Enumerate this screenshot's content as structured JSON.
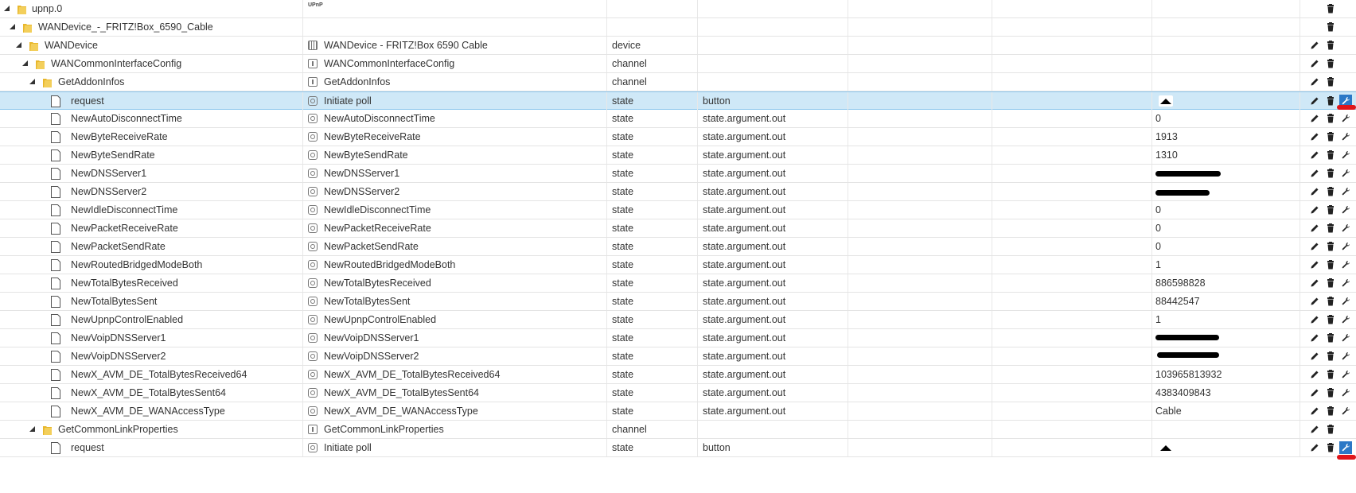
{
  "rows": [
    {
      "name": "upnp.0",
      "title": "",
      "type": "",
      "role": "",
      "value": ""
    },
    {
      "name": "WANDevice_-_FRITZ!Box_6590_Cable",
      "title": "",
      "type": "",
      "role": "",
      "value": ""
    },
    {
      "name": "WANDevice",
      "title": "WANDevice - FRITZ!Box 6590 Cable",
      "type": "device",
      "role": "",
      "value": ""
    },
    {
      "name": "WANCommonInterfaceConfig",
      "title": "WANCommonInterfaceConfig",
      "type": "channel",
      "role": "",
      "value": ""
    },
    {
      "name": "GetAddonInfos",
      "title": "GetAddonInfos",
      "type": "channel",
      "role": "",
      "value": ""
    },
    {
      "name": "request",
      "title": "Initiate poll",
      "type": "state",
      "role": "button",
      "value": ""
    },
    {
      "name": "NewAutoDisconnectTime",
      "title": "NewAutoDisconnectTime",
      "type": "state",
      "role": "state.argument.out",
      "value": "0"
    },
    {
      "name": "NewByteReceiveRate",
      "title": "NewByteReceiveRate",
      "type": "state",
      "role": "state.argument.out",
      "value": "1913"
    },
    {
      "name": "NewByteSendRate",
      "title": "NewByteSendRate",
      "type": "state",
      "role": "state.argument.out",
      "value": "1310"
    },
    {
      "name": "NewDNSServer1",
      "title": "NewDNSServer1",
      "type": "state",
      "role": "state.argument.out",
      "value": ""
    },
    {
      "name": "NewDNSServer2",
      "title": "NewDNSServer2",
      "type": "state",
      "role": "state.argument.out",
      "value": ""
    },
    {
      "name": "NewIdleDisconnectTime",
      "title": "NewIdleDisconnectTime",
      "type": "state",
      "role": "state.argument.out",
      "value": "0"
    },
    {
      "name": "NewPacketReceiveRate",
      "title": "NewPacketReceiveRate",
      "type": "state",
      "role": "state.argument.out",
      "value": "0"
    },
    {
      "name": "NewPacketSendRate",
      "title": "NewPacketSendRate",
      "type": "state",
      "role": "state.argument.out",
      "value": "0"
    },
    {
      "name": "NewRoutedBridgedModeBoth",
      "title": "NewRoutedBridgedModeBoth",
      "type": "state",
      "role": "state.argument.out",
      "value": "1"
    },
    {
      "name": "NewTotalBytesReceived",
      "title": "NewTotalBytesReceived",
      "type": "state",
      "role": "state.argument.out",
      "value": "886598828"
    },
    {
      "name": "NewTotalBytesSent",
      "title": "NewTotalBytesSent",
      "type": "state",
      "role": "state.argument.out",
      "value": "88442547"
    },
    {
      "name": "NewUpnpControlEnabled",
      "title": "NewUpnpControlEnabled",
      "type": "state",
      "role": "state.argument.out",
      "value": "1"
    },
    {
      "name": "NewVoipDNSServer1",
      "title": "NewVoipDNSServer1",
      "type": "state",
      "role": "state.argument.out",
      "value": ""
    },
    {
      "name": "NewVoipDNSServer2",
      "title": "NewVoipDNSServer2",
      "type": "state",
      "role": "state.argument.out",
      "value": ""
    },
    {
      "name": "NewX_AVM_DE_TotalBytesReceived64",
      "title": "NewX_AVM_DE_TotalBytesReceived64",
      "type": "state",
      "role": "state.argument.out",
      "value": "103965813932"
    },
    {
      "name": "NewX_AVM_DE_TotalBytesSent64",
      "title": "NewX_AVM_DE_TotalBytesSent64",
      "type": "state",
      "role": "state.argument.out",
      "value": "4383409843"
    },
    {
      "name": "NewX_AVM_DE_WANAccessType",
      "title": "NewX_AVM_DE_WANAccessType",
      "type": "state",
      "role": "state.argument.out",
      "value": "Cable"
    },
    {
      "name": "GetCommonLinkProperties",
      "title": "GetCommonLinkProperties",
      "type": "channel",
      "role": "",
      "value": ""
    },
    {
      "name": "request",
      "title": "Initiate poll",
      "type": "state",
      "role": "button",
      "value": ""
    }
  ],
  "upnp_logo": "UPnP",
  "icons": {
    "edit": "pencil-icon",
    "delete": "trash-icon",
    "settings": "wrench-icon",
    "push": "push-button-icon"
  },
  "colors": {
    "selected_row": "#cfe8f7",
    "wrench_highlight": "#2b78c6",
    "red_marker": "#e0151a"
  }
}
